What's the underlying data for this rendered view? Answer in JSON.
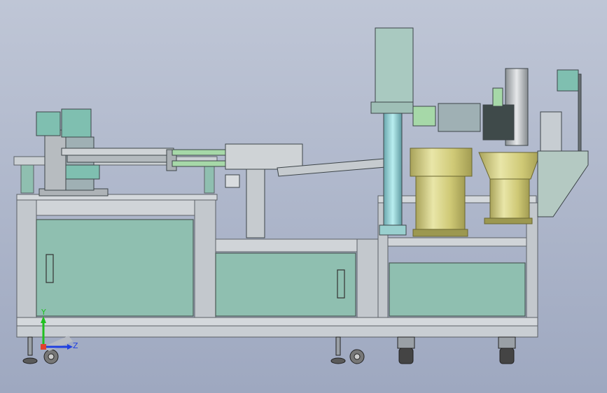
{
  "axes": {
    "y_label": "Y",
    "z_label": "Z",
    "y_color": "#20c020",
    "z_color": "#2040e0"
  },
  "colors": {
    "frame": "#c7cdd2",
    "panel": "#8fbfb0",
    "panel_dark": "#7aa899",
    "bowl": "#d8d48a",
    "bowl_shade": "#bdb86a",
    "motor_block": "#a9c9c0",
    "cylinder": "#7fcfd0",
    "rail": "#a6d8a8",
    "metal": "#b8bcc0"
  },
  "icons": {
    "orientation_triad": "xyz-triad-icon"
  }
}
